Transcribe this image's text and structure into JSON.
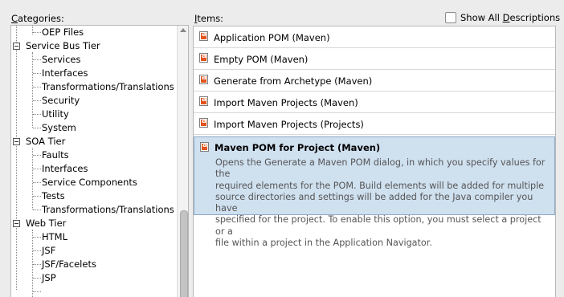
{
  "categories": {
    "label_underlined": "C",
    "label_rest": "ategories:",
    "tree": [
      {
        "label": "OEP Files",
        "level": 1
      },
      {
        "label": "Service Bus Tier",
        "level": 0
      },
      {
        "label": "Services",
        "level": 1
      },
      {
        "label": "Interfaces",
        "level": 1
      },
      {
        "label": "Transformations/Translations",
        "level": 1
      },
      {
        "label": "Security",
        "level": 1
      },
      {
        "label": "Utility",
        "level": 1
      },
      {
        "label": "System",
        "level": 1
      },
      {
        "label": "SOA Tier",
        "level": 0
      },
      {
        "label": "Faults",
        "level": 1
      },
      {
        "label": "Interfaces",
        "level": 1
      },
      {
        "label": "Service Components",
        "level": 1
      },
      {
        "label": "Tests",
        "level": 1
      },
      {
        "label": "Transformations/Translations",
        "level": 1
      },
      {
        "label": "Web Tier",
        "level": 0
      },
      {
        "label": "HTML",
        "level": 1
      },
      {
        "label": "JSF",
        "level": 1
      },
      {
        "label": "JSF/Facelets",
        "level": 1
      },
      {
        "label": "JSP",
        "level": 1
      }
    ]
  },
  "items": {
    "label_underlined": "I",
    "label_rest": "tems:",
    "show_all_prefix": "Show All ",
    "show_all_underlined": "D",
    "show_all_suffix": "escriptions",
    "show_all_checked": false,
    "list": [
      {
        "label": "Application POM (Maven)"
      },
      {
        "label": "Empty POM (Maven)"
      },
      {
        "label": "Generate from Archetype (Maven)"
      },
      {
        "label": "Import Maven Projects (Maven)"
      },
      {
        "label": "Import Maven Projects (Projects)"
      },
      {
        "label": "Maven POM for Project (Maven)",
        "selected": true,
        "description_lines": [
          "Opens the Generate a Maven POM dialog, in which you specify values for the",
          "required elements for the POM. Build elements will be added for multiple",
          "source directories and settings will be added for the Java compiler you have",
          "specified for the project. To enable this option, you must select a project or a",
          "file within a project in the Application Navigator."
        ]
      }
    ]
  }
}
